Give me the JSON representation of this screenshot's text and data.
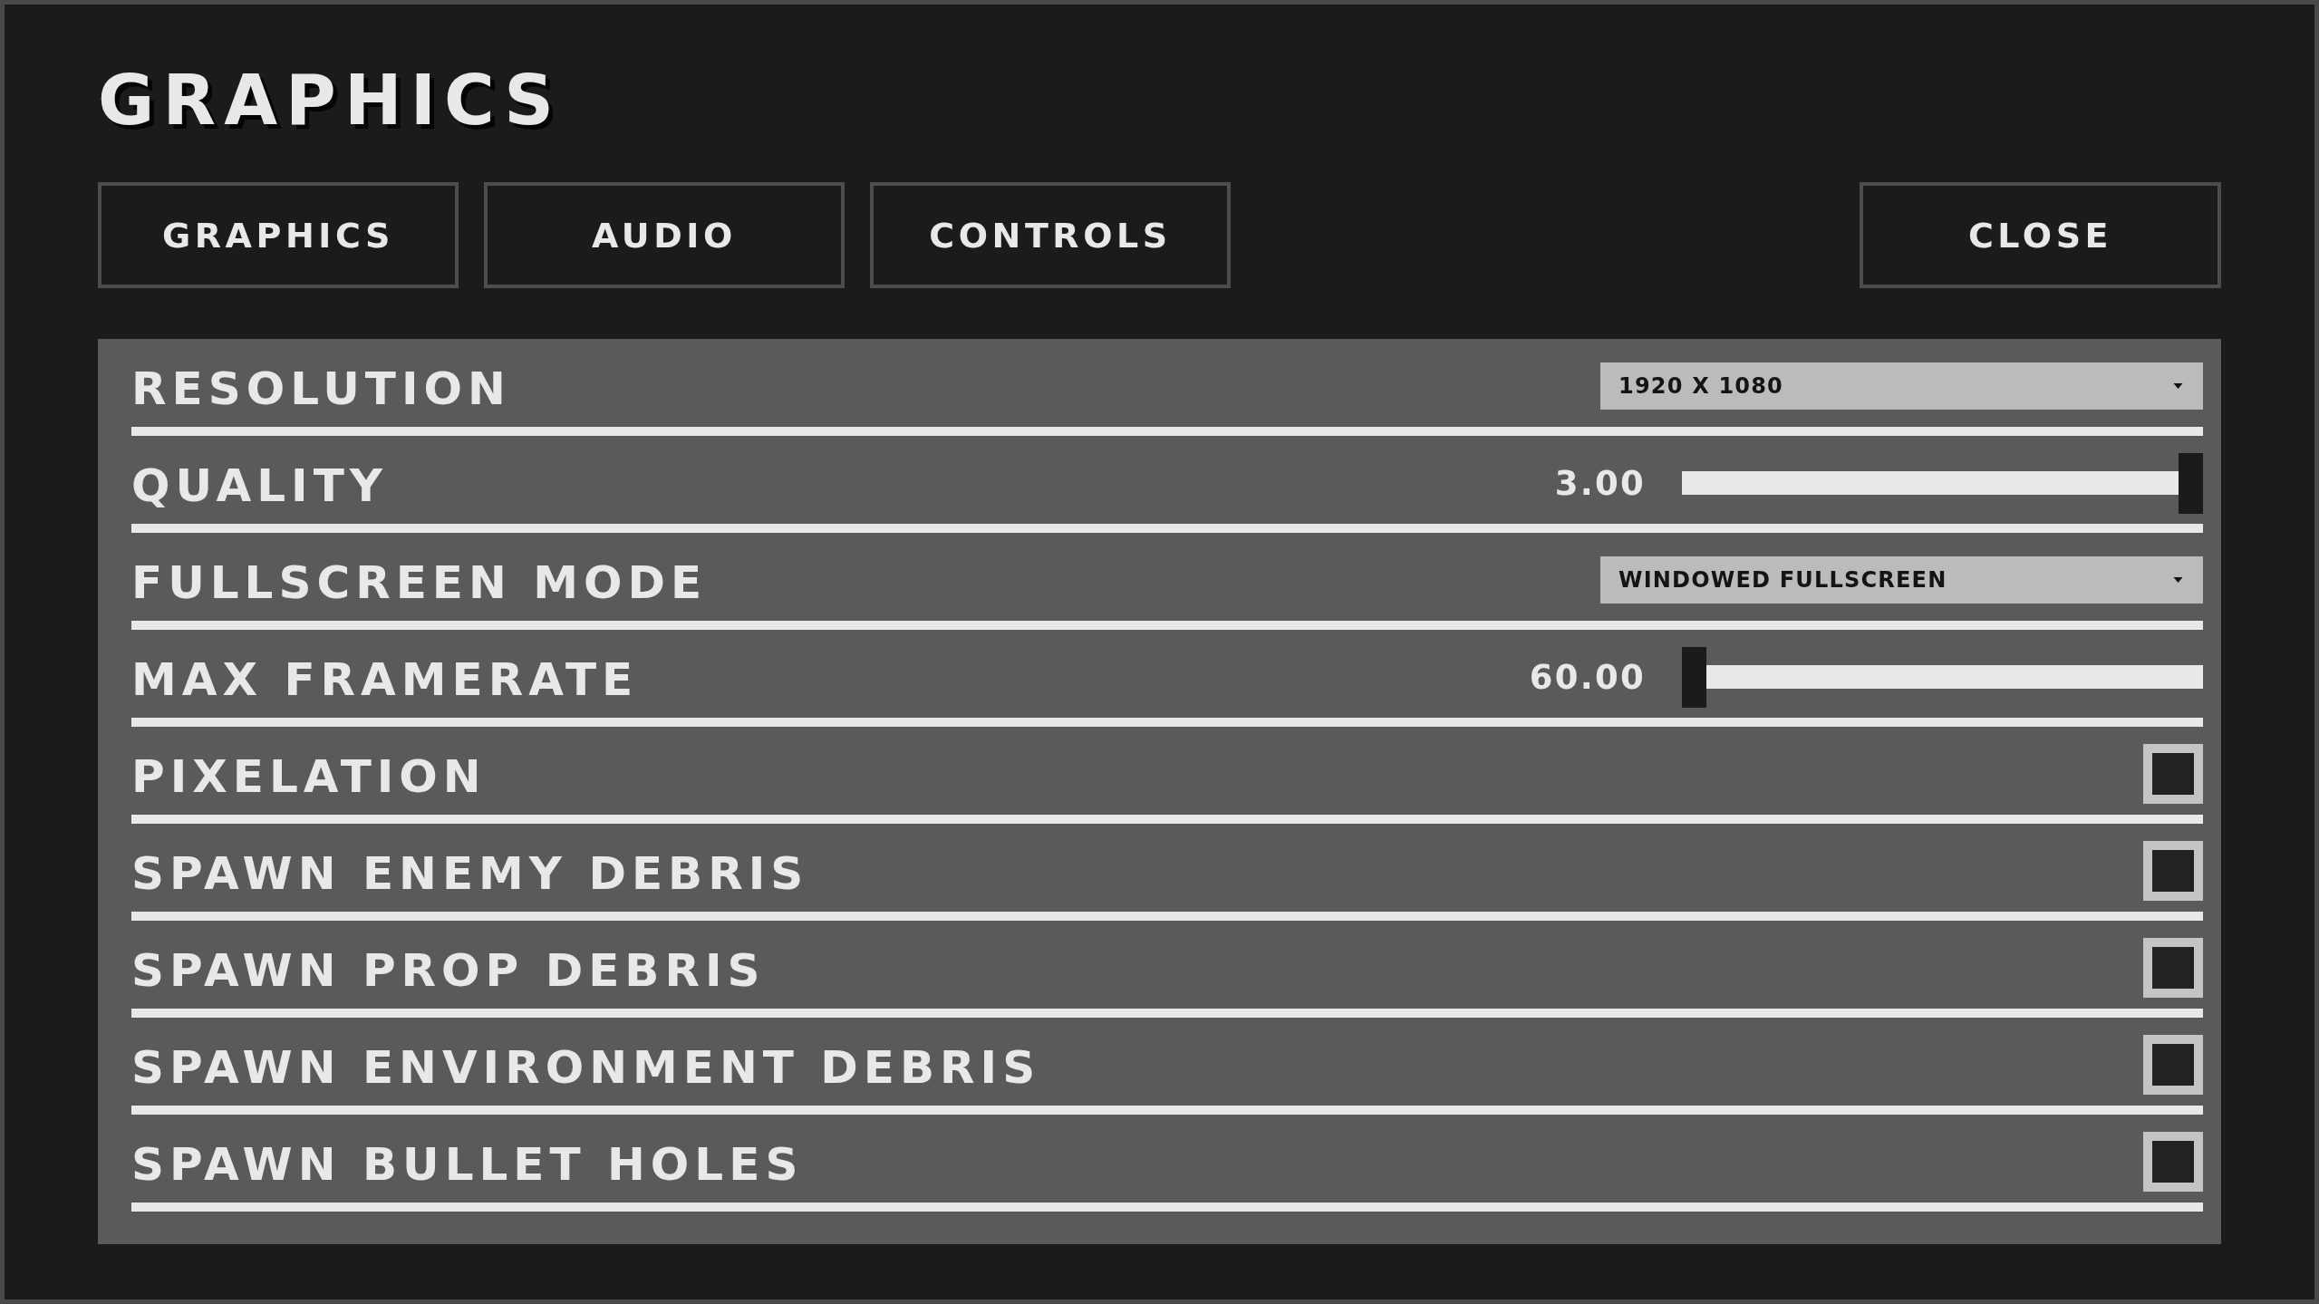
{
  "title": "GRAPHICS",
  "tabs": [
    {
      "label": "GRAPHICS"
    },
    {
      "label": "AUDIO"
    },
    {
      "label": "CONTROLS"
    }
  ],
  "close_button": "CLOSE",
  "settings": [
    {
      "kind": "dropdown",
      "label": "RESOLUTION",
      "value": "1920 X 1080"
    },
    {
      "kind": "slider",
      "label": "QUALITY",
      "reading": "3.00",
      "level": 1
    },
    {
      "kind": "dropdown",
      "label": "FULLSCREEN MODE",
      "value": "WINDOWED FULLSCREEN"
    },
    {
      "kind": "slider",
      "label": "MAX FRAMERATE",
      "reading": "60.00",
      "level": 0
    },
    {
      "kind": "checkbox",
      "label": "PIXELATION",
      "checked": false
    },
    {
      "kind": "checkbox",
      "label": "SPAWN ENEMY DEBRIS",
      "checked": false
    },
    {
      "kind": "checkbox",
      "label": "SPAWN PROP DEBRIS",
      "checked": false
    },
    {
      "kind": "checkbox",
      "label": "SPAWN ENVIRONMENT DEBRIS",
      "checked": false
    },
    {
      "kind": "checkbox",
      "label": "SPAWN BULLET HOLES",
      "checked": false
    }
  ]
}
